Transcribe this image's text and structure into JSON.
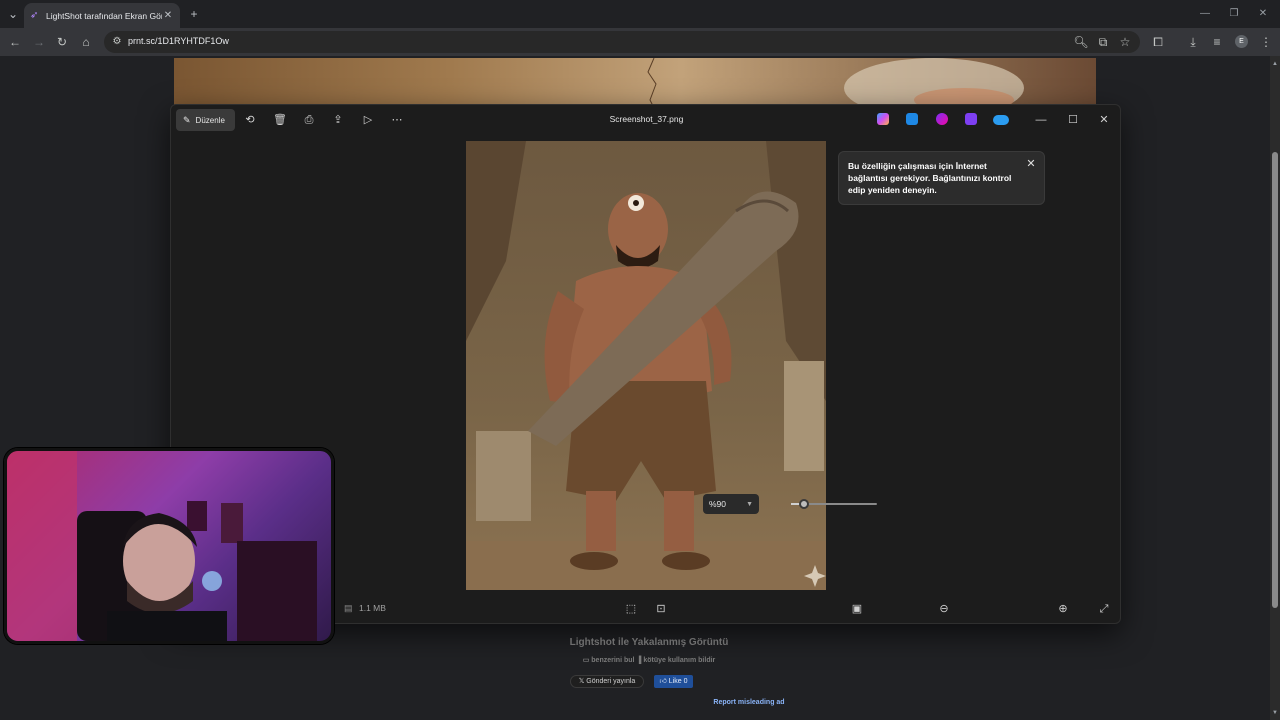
{
  "browser": {
    "tab_title": "LightShot tarafından Ekran Görüntüsü",
    "tab_close": "✕",
    "new_tab": "+",
    "url": "prnt.sc/1D1RYHTDF1Ow",
    "profile_initial": "E"
  },
  "photos_app": {
    "edit_label": "Düzenle",
    "filename": "Screenshot_37.png",
    "file_size": "1.1 MB",
    "zoom": "%90",
    "zoom_slider_level": 0.15,
    "notification": "Bu özelliğin çalışması için İnternet bağlantısı gerekiyor. Bağlantınızı kontrol edip yeniden deneyin."
  },
  "lightshot": {
    "title": "Lightshot ile Yakalanmış Görüntü",
    "find_similar": "benzerini bul",
    "report_abuse": "kötüye kullanım bildir",
    "post_button": "Gönderi yayınla",
    "like_button": "Like 0",
    "report_ad": "Report misleading ad"
  },
  "colors": {
    "browser_bg": "#202124",
    "toolbar_bg": "#35363a",
    "photos_bg": "#1c1c1c",
    "link_blue": "#8ab4f8",
    "fb_blue": "#1f4f9a"
  }
}
